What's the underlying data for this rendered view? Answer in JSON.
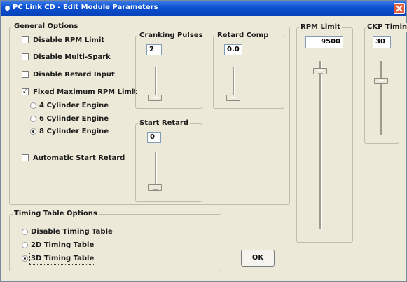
{
  "window": {
    "title": "PC Link CD - Edit Module Parameters"
  },
  "general": {
    "legend": "General Options",
    "options": [
      {
        "label": "Disable RPM Limit",
        "checked": false
      },
      {
        "label": "Disable Multi-Spark",
        "checked": false
      },
      {
        "label": "Disable Retard Input",
        "checked": false
      },
      {
        "label": "Fixed Maximum RPM Limit",
        "checked": true
      }
    ],
    "cylinders": [
      {
        "label": "4 Cylinder Engine",
        "selected": false
      },
      {
        "label": "6 Cylinder Engine",
        "selected": false
      },
      {
        "label": "8 Cylinder Engine",
        "selected": true
      }
    ],
    "auto_start_retard": {
      "label": "Automatic Start Retard",
      "checked": false
    }
  },
  "cranking_pulses": {
    "legend": "Cranking Pulses",
    "value": "2"
  },
  "retard_comp": {
    "legend": "Retard Comp",
    "value": "0.0"
  },
  "start_retard": {
    "legend": "Start Retard",
    "value": "0"
  },
  "rpm_limit": {
    "legend": "RPM Limit",
    "value": "9500"
  },
  "ckp_timing": {
    "legend": "CKP Timing",
    "value": "30"
  },
  "timing_table": {
    "legend": "Timing Table Options",
    "options": [
      {
        "label": "Disable Timing Table",
        "selected": false
      },
      {
        "label": "2D Timing Table",
        "selected": false
      },
      {
        "label": "3D Timing Table",
        "selected": true
      }
    ]
  },
  "buttons": {
    "ok": "OK"
  },
  "icons": {
    "title": "app-icon",
    "close": "close-icon"
  }
}
